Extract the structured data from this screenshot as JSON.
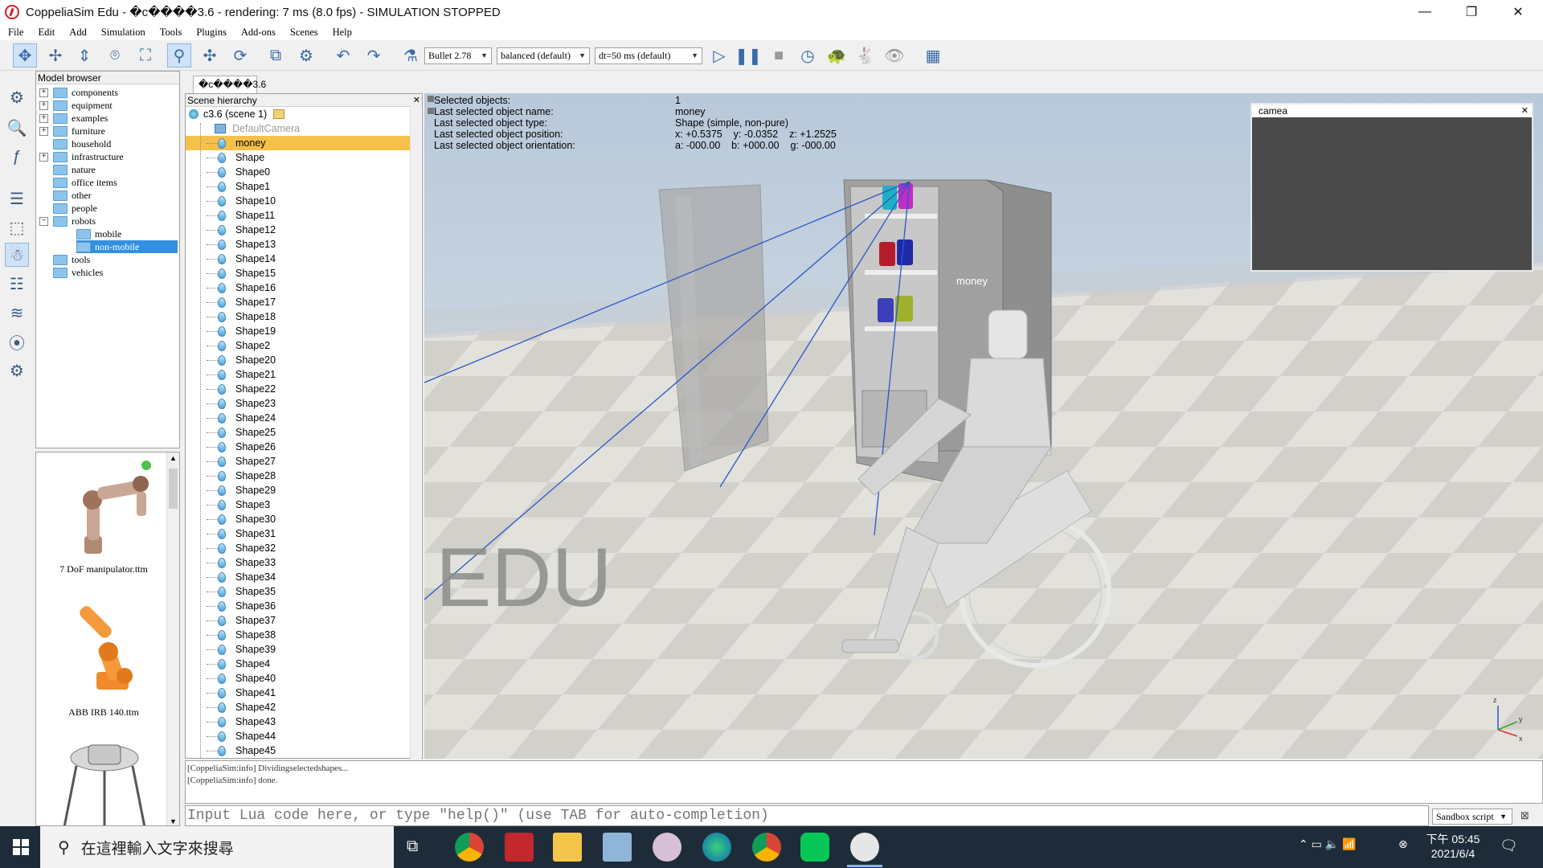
{
  "window": {
    "title": "CoppeliaSim Edu - \u0000c\u0000\u0000\u0000\u00003.6 - rendering: 7 ms (8.0 fps) - SIMULATION STOPPED",
    "title_display": "CoppeliaSim Edu - �c����3.6 - rendering: 7 ms (8.0 fps) - SIMULATION STOPPED",
    "minimize": "—",
    "restore": "❐",
    "close": "✕"
  },
  "menu": [
    "File",
    "Edit",
    "Add",
    "Simulation",
    "Tools",
    "Plugins",
    "Add-ons",
    "Scenes",
    "Help"
  ],
  "toolbar": {
    "engine": "Bullet 2.78",
    "accuracy": "balanced (default)",
    "timestep": "dt=50 ms (default)",
    "icons": [
      "move-camera-icon",
      "rotate-camera-icon",
      "shift-camera-icon",
      "camera-angle-icon",
      "fit-to-view-icon",
      "select-icon",
      "translate-object-icon",
      "rotate-object-icon",
      "assemble-icon",
      "transfer-dna-icon",
      "undo-icon",
      "redo-icon",
      "dynamics-icon",
      "play-icon",
      "pause-icon",
      "stop-icon",
      "realtime-icon",
      "slow-down-icon",
      "speed-up-icon",
      "visualization-icon",
      "page-selector-icon"
    ]
  },
  "model_browser": {
    "header": "Model browser",
    "folders": [
      {
        "label": "components",
        "expandable": true
      },
      {
        "label": "equipment",
        "expandable": true
      },
      {
        "label": "examples",
        "expandable": true
      },
      {
        "label": "furniture",
        "expandable": true
      },
      {
        "label": "household",
        "expandable": false
      },
      {
        "label": "infrastructure",
        "expandable": true
      },
      {
        "label": "nature",
        "expandable": false
      },
      {
        "label": "office items",
        "expandable": false
      },
      {
        "label": "other",
        "expandable": false
      },
      {
        "label": "people",
        "expandable": false
      },
      {
        "label": "robots",
        "expandable": true,
        "expanded": true
      },
      {
        "label": "mobile",
        "child": true
      },
      {
        "label": "non-mobile",
        "child": true,
        "selected": true
      },
      {
        "label": "tools",
        "expandable": false
      },
      {
        "label": "vehicles",
        "expandable": false
      }
    ],
    "thumbnails": [
      {
        "caption": "7 DoF manipulator.ttm"
      },
      {
        "caption": "ABB IRB 140.ttm"
      },
      {
        "caption": ""
      }
    ]
  },
  "scene_tab": {
    "label": "\u0000c\u0000\u0000\u0000\u00003.6",
    "label_display": "�c����3.6"
  },
  "scene_hierarchy": {
    "header": "Scene hierarchy",
    "root": "c3.6 (scene 1)",
    "camera": "DefaultCamera",
    "items": [
      "money",
      "Shape",
      "Shape0",
      "Shape1",
      "Shape10",
      "Shape11",
      "Shape12",
      "Shape13",
      "Shape14",
      "Shape15",
      "Shape16",
      "Shape17",
      "Shape18",
      "Shape19",
      "Shape2",
      "Shape20",
      "Shape21",
      "Shape22",
      "Shape23",
      "Shape24",
      "Shape25",
      "Shape26",
      "Shape27",
      "Shape28",
      "Shape29",
      "Shape3",
      "Shape30",
      "Shape31",
      "Shape32",
      "Shape33",
      "Shape34",
      "Shape35",
      "Shape36",
      "Shape37",
      "Shape38",
      "Shape39",
      "Shape4",
      "Shape40",
      "Shape41",
      "Shape42",
      "Shape43",
      "Shape44",
      "Shape45"
    ],
    "selected": "money"
  },
  "info_overlay": {
    "labels": [
      "Selected objects:",
      "Last selected object name:",
      "Last selected object type:",
      "Last selected object position:",
      "Last selected object orientation:"
    ],
    "values": [
      "1",
      "money",
      "Shape (simple, non-pure)",
      "x: +0.5375    y: -0.0352    z: +1.2525",
      "a: -000.00    b: +000.00    g: -000.00"
    ]
  },
  "viewport": {
    "object_label": "money",
    "watermark": "EDU",
    "camera_window_title": "camea",
    "axis_labels": [
      "z",
      "x",
      "y"
    ]
  },
  "console": {
    "lines": [
      "[CoppeliaSim:info] Dividingselectedshapes...",
      "[CoppeliaSim:info] done."
    ],
    "input_placeholder": "Input Lua code here, or type \"help()\" (use TAB for auto-completion)",
    "script_mode": "Sandbox script"
  },
  "taskbar": {
    "search_placeholder": "在這裡輸入文字來搜尋",
    "time": "下午 05:45",
    "date": "2021/6/4"
  },
  "colors": {
    "selection": "#f5c14a",
    "tree_selection": "#3390e0",
    "taskbar": "#1e2c3a",
    "ray": "#2a56c8"
  }
}
